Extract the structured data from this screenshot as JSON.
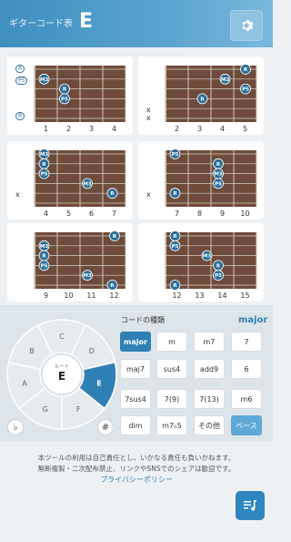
{
  "header": {
    "app_title": "ギターコード表",
    "key": "E",
    "settings_icon": "gear-icon"
  },
  "colors": {
    "accent": "#2f80b4",
    "root_marker": "#2d6f99",
    "fretboard": "#6e4b3a"
  },
  "diagrams": [
    {
      "frets": [
        "1",
        "2",
        "3",
        "4"
      ],
      "left_marks": [
        "R",
        "P5",
        "",
        "",
        "R"
      ],
      "left_x": [],
      "dots": [
        {
          "s": 1,
          "f": 0.4,
          "label": "M3"
        },
        {
          "s": 2,
          "f": 1.3,
          "label": "R"
        },
        {
          "s": 3,
          "f": 1.3,
          "label": "P5"
        }
      ]
    },
    {
      "frets": [
        "2",
        "3",
        "4",
        "5"
      ],
      "left_marks": [],
      "left_x": [
        "x",
        "x"
      ],
      "dots": [
        {
          "s": 0,
          "f": 3.5,
          "label": "R"
        },
        {
          "s": 1,
          "f": 2.6,
          "label": "M3"
        },
        {
          "s": 2,
          "f": 3.5,
          "label": "P5"
        },
        {
          "s": 3,
          "f": 1.6,
          "label": "R"
        }
      ]
    },
    {
      "frets": [
        "4",
        "5",
        "6",
        "7"
      ],
      "left_marks": [],
      "left_x": [
        "x"
      ],
      "dots": [
        {
          "s": 0,
          "f": 0.4,
          "label": "M3"
        },
        {
          "s": 1,
          "f": 0.4,
          "label": "R"
        },
        {
          "s": 2,
          "f": 0.4,
          "label": "P5"
        },
        {
          "s": 3,
          "f": 2.3,
          "label": "M3"
        },
        {
          "s": 4,
          "f": 3.4,
          "label": "R"
        }
      ]
    },
    {
      "frets": [
        "7",
        "8",
        "9",
        "10"
      ],
      "left_marks": [],
      "left_x": [
        "x"
      ],
      "dots": [
        {
          "s": 0,
          "f": 0.4,
          "label": "P5"
        },
        {
          "s": 1,
          "f": 2.3,
          "label": "R"
        },
        {
          "s": 2,
          "f": 2.3,
          "label": "M3"
        },
        {
          "s": 3,
          "f": 2.3,
          "label": "P5"
        },
        {
          "s": 4,
          "f": 0.4,
          "label": "R"
        }
      ]
    },
    {
      "frets": [
        "9",
        "10",
        "11",
        "12"
      ],
      "left_marks": [],
      "left_x": [],
      "dots": [
        {
          "s": 0,
          "f": 3.5,
          "label": "R"
        },
        {
          "s": 1,
          "f": 0.4,
          "label": "M3"
        },
        {
          "s": 2,
          "f": 0.4,
          "label": "R"
        },
        {
          "s": 3,
          "f": 0.4,
          "label": "P5"
        },
        {
          "s": 4,
          "f": 2.3,
          "label": "M3"
        },
        {
          "s": 5,
          "f": 3.4,
          "label": "R"
        }
      ]
    },
    {
      "frets": [
        "12",
        "13",
        "14",
        "15"
      ],
      "left_marks": [],
      "left_x": [],
      "dots": [
        {
          "s": 0,
          "f": 0.4,
          "label": "R"
        },
        {
          "s": 1,
          "f": 0.4,
          "label": "P5"
        },
        {
          "s": 2,
          "f": 1.8,
          "label": "M3"
        },
        {
          "s": 3,
          "f": 2.3,
          "label": "R"
        },
        {
          "s": 4,
          "f": 2.3,
          "label": "P5"
        },
        {
          "s": 5,
          "f": 0.4,
          "label": "R"
        }
      ]
    }
  ],
  "wheel": {
    "notes": [
      "C",
      "D",
      "E",
      "F",
      "G",
      "A",
      "B"
    ],
    "selected": "E",
    "center_label": "ルート",
    "center_value": "E",
    "flat": "♭",
    "sharp": "#"
  },
  "chord_types": {
    "title": "コードの種類",
    "current": "major",
    "rows": [
      [
        "major",
        "m",
        "m7",
        "7"
      ],
      [
        "maj7",
        "sus4",
        "add9",
        "6"
      ],
      [
        "7sus4",
        "7(9)",
        "7(13)",
        "m6"
      ],
      [
        "dim",
        "m7♭5",
        "その他",
        "ベース"
      ]
    ]
  },
  "footer": {
    "line1": "本ツールの利用は自己責任とし、いかなる責任も負いかねます。",
    "line2": "無断複製・二次配布禁止、リンクやSNSでのシェアは歓迎です。",
    "privacy": "プライバシーポリシー",
    "fab_icon": "music-list-icon"
  }
}
